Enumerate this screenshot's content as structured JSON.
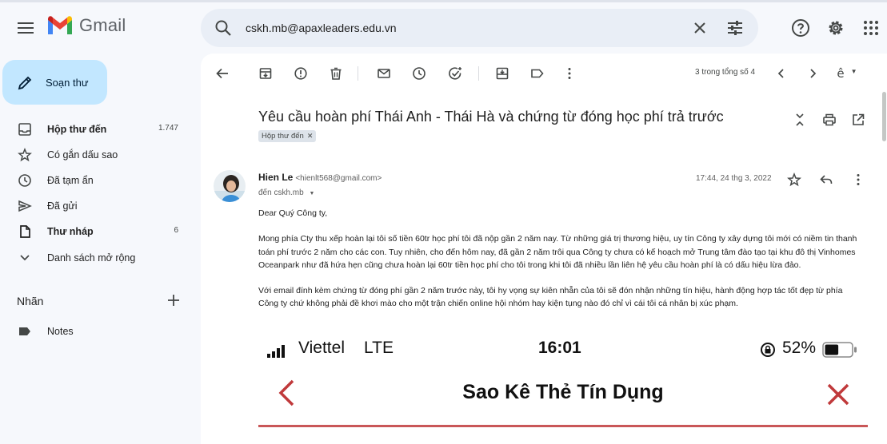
{
  "app": {
    "name": "Gmail"
  },
  "search": {
    "query": "cskh.mb@apaxleaders.edu.vn"
  },
  "sidebar": {
    "compose_label": "Soạn thư",
    "items": [
      {
        "label": "Hộp thư đến",
        "count": "1.747",
        "bold": true,
        "icon": "inbox-icon"
      },
      {
        "label": "Có gắn dấu sao",
        "count": "",
        "bold": false,
        "icon": "star-icon"
      },
      {
        "label": "Đã tạm ẩn",
        "count": "",
        "bold": false,
        "icon": "clock-icon"
      },
      {
        "label": "Đã gửi",
        "count": "",
        "bold": false,
        "icon": "send-icon"
      },
      {
        "label": "Thư nháp",
        "count": "6",
        "bold": true,
        "icon": "draft-icon"
      },
      {
        "label": "Danh sách mở rộng",
        "count": "",
        "bold": false,
        "icon": "chevron-down-icon"
      }
    ],
    "labels_title": "Nhãn",
    "labels": [
      {
        "label": "Notes",
        "icon": "label-icon"
      }
    ]
  },
  "toolbar": {
    "pager": "3 trong tổng số 4"
  },
  "email": {
    "subject": "Yêu cầu hoàn phí Thái Anh - Thái Hà và chứng từ đóng học phí trả trước",
    "label_chip": "Hộp thư đến",
    "sender_name": "Hien Le",
    "sender_email": "<hienlt568@gmail.com>",
    "to": "đến cskh.mb",
    "date": "17:44, 24 thg 3, 2022",
    "greeting": "Dear Quý Công ty,",
    "paragraph1": "Mong phía Cty thu xếp hoàn lại tôi số tiền 60tr học phí tôi đã nộp gần 2 năm nay. Từ những giá trị thương hiệu, uy tín Công ty xây dựng tôi mới có niềm tin thanh toán phí trước 2 năm cho các con. Tuy nhiên, cho đến hôm nay, đã gần 2 năm trôi qua Công ty chưa có kế hoạch mở Trung tâm đào tạo tại khu đô thị Vinhomes Oceanpark như đã hứa hẹn cũng chưa hoàn lại 60tr tiền học phí cho tôi trong khi tôi đã nhiều lần liên hệ yêu cầu hoàn phí là có dấu hiệu lừa đảo.",
    "paragraph2": "Với email đính kèm chứng từ đóng phí gần 2 năm trước này, tôi hy vọng sự kiên nhẫn của tôi sẽ đón nhận những tín hiệu, hành động hợp tác tốt đẹp từ phía Công ty chứ không phải đề khơi mào cho một trận chiến online hội nhóm hay kiện tụng nào đó chỉ vì cái tôi cá nhân bị xúc phạm."
  },
  "attachment": {
    "carrier": "Viettel",
    "network": "LTE",
    "time": "16:01",
    "battery": "52%",
    "battery_level": 0.52,
    "title": "Sao Kê Thẻ Tín Dụng",
    "accent": "#c0393b"
  },
  "colors": {
    "compose_bg": "#c2e7ff",
    "search_bg": "#e9eef6",
    "app_bg": "#f6f8fc"
  }
}
